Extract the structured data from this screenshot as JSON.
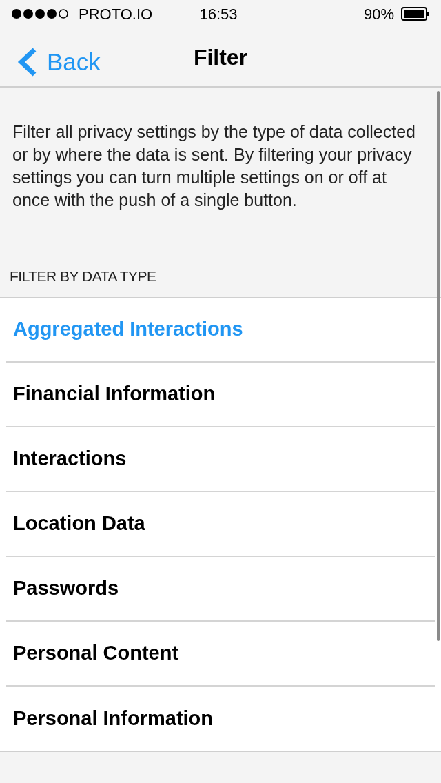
{
  "status_bar": {
    "carrier": "PROTO.IO",
    "time": "16:53",
    "battery": "90%"
  },
  "nav_bar": {
    "back": "Back",
    "title": "Filter"
  },
  "description": "Filter all privacy settings by the type of data collected or by where the data is sent. By filtering your privacy settings you can turn multiple settings on or off at once with the push of a single button.",
  "section_header": "FILTER BY DATA TYPE",
  "items": [
    {
      "label": "Aggregated Interactions",
      "selected": true
    },
    {
      "label": "Financial Information",
      "selected": false
    },
    {
      "label": "Interactions",
      "selected": false
    },
    {
      "label": "Location Data",
      "selected": false
    },
    {
      "label": "Passwords",
      "selected": false
    },
    {
      "label": "Personal Content",
      "selected": false
    },
    {
      "label": "Personal Information",
      "selected": false
    }
  ]
}
